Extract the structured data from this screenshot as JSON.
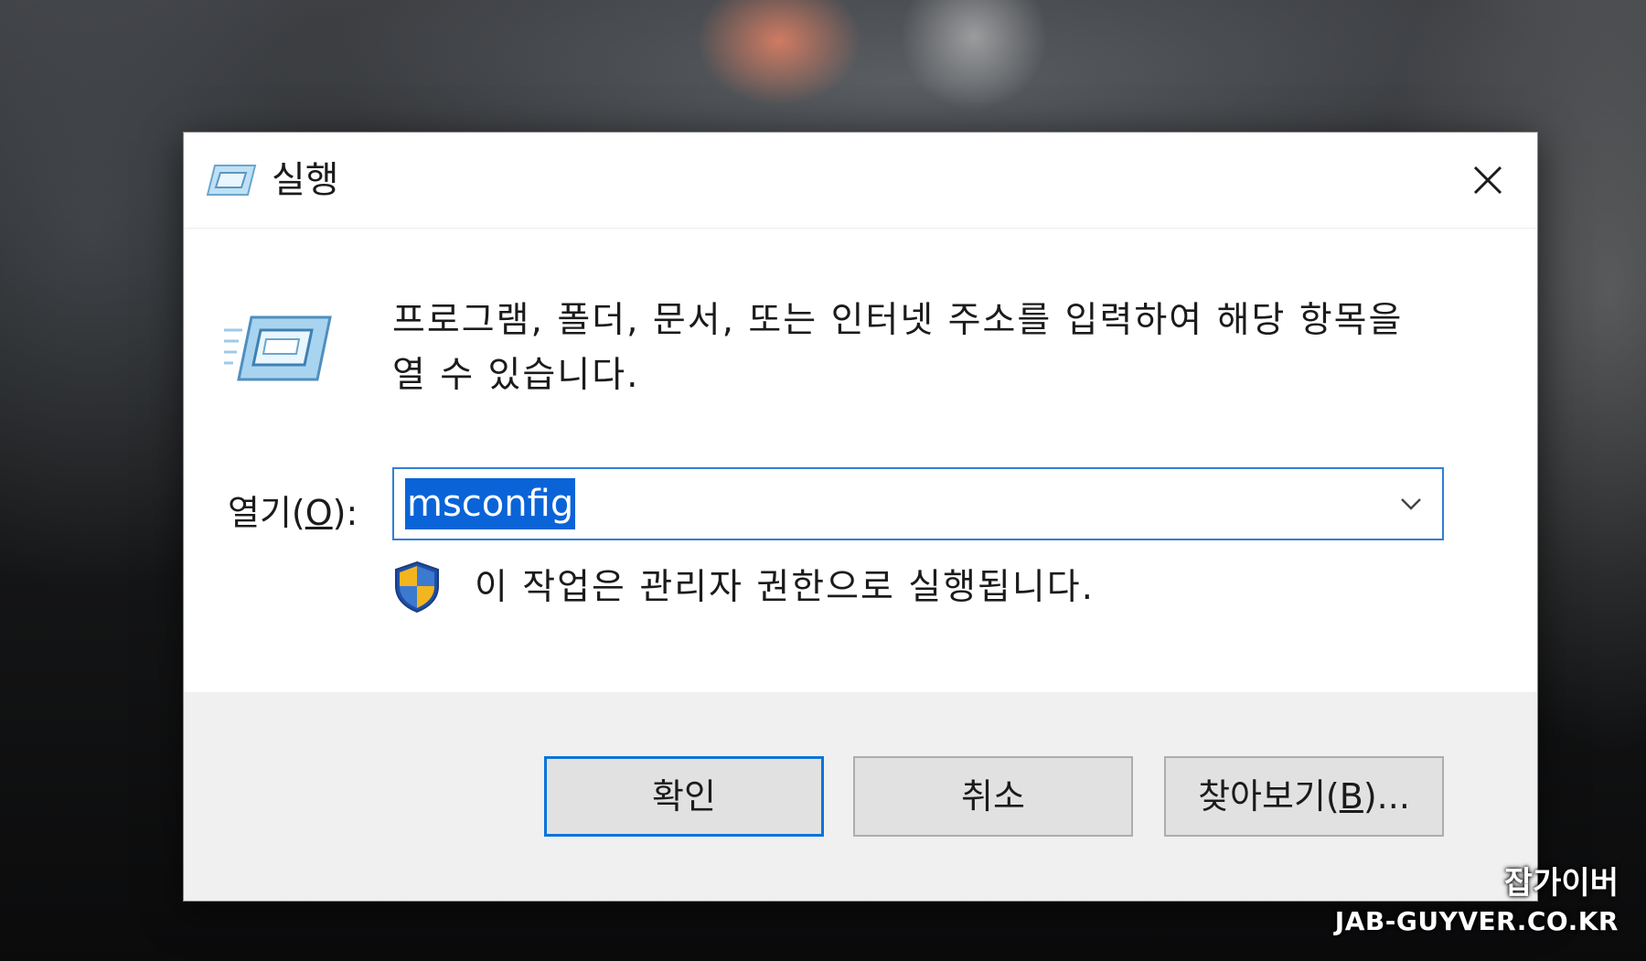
{
  "window": {
    "title": "실행",
    "close_icon": "close-icon"
  },
  "body": {
    "description": "프로그램, 폴더, 문서, 또는 인터넷 주소를 입력하여 해당 항목을 열 수 있습니다.",
    "open_label_prefix": "열기(",
    "open_label_mnemonic": "O",
    "open_label_suffix": "):",
    "input_value": "msconfig",
    "admin_note": "이 작업은 관리자 권한으로 실행됩니다."
  },
  "buttons": {
    "ok_label": "확인",
    "cancel_label": "취소",
    "browse_prefix": "찾아보기(",
    "browse_mnemonic": "B",
    "browse_suffix": ")..."
  },
  "watermark": {
    "line1": "잡가이버",
    "line2": "JAB-GUYVER.CO.KR"
  },
  "colors": {
    "accent": "#0a74da",
    "selection": "#0a64d8",
    "footer_bg": "#f0f0f0"
  }
}
